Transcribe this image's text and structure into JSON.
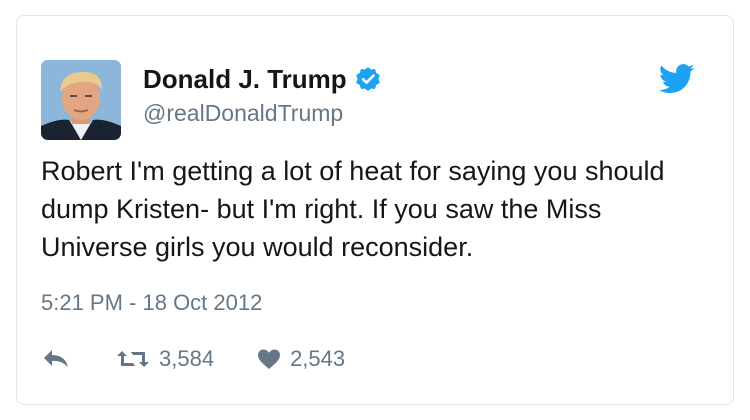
{
  "tweet": {
    "author_name": "Donald J. Trump",
    "handle": "@realDonaldTrump",
    "text": "Robert I'm getting a lot of heat for saying you should dump Kristen- but I'm right. If you saw the Miss Universe girls you would reconsider.",
    "timestamp": "5:21 PM - 18 Oct 2012",
    "retweet_count": "3,584",
    "like_count": "2,543"
  },
  "icons": {
    "verified": "verified-badge-icon",
    "brand": "twitter-bird-icon",
    "reply": "reply-icon",
    "retweet": "retweet-icon",
    "like": "heart-icon"
  },
  "colors": {
    "name": "#14171a",
    "secondary": "#657786",
    "brand_blue": "#1da1f2",
    "border": "#e1e8ed"
  }
}
